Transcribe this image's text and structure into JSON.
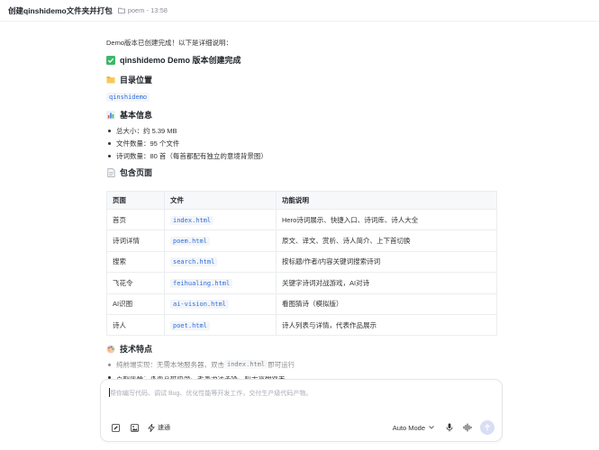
{
  "header": {
    "title": "创建qinshidemo文件夹并打包",
    "folder": "poem",
    "time": "13:58"
  },
  "message": {
    "intro": "Demo版本已创建完成！以下是详细说明：",
    "done_heading": "qinshidemo Demo 版本创建完成",
    "dir_heading": "目录位置",
    "dir_value": "qinshidemo",
    "info_heading": "基本信息",
    "info_items": [
      "总大小：约 5.39 MB",
      "文件数量：95 个文件",
      "诗词数量：80 首（每首都配有独立的意境背景图）"
    ],
    "pages_heading": "包含页面",
    "table": {
      "headers": [
        "页面",
        "文件",
        "功能说明"
      ],
      "rows": [
        [
          "首页",
          "index.html",
          "Hero诗词展示、快捷入口、诗词库、诗人大全"
        ],
        [
          "诗词详情",
          "poem.html",
          "原文、译文、赏析、诗人简介、上下首切换"
        ],
        [
          "搜索",
          "search.html",
          "按标题/作者/内容关键词搜索诗词"
        ],
        [
          "飞花令",
          "feihualing.html",
          "关键字诗词对战游戏，AI对诗"
        ],
        [
          "AI识图",
          "ai-vision.html",
          "看图猜诗（模拟版）"
        ],
        [
          "诗人",
          "poet.html",
          "诗人列表与详情，代表作品展示"
        ]
      ]
    },
    "tech_heading": "技术特点",
    "tech_items": [
      {
        "before": "纯前端实现：无需本地服务器，双击 ",
        "code": "index.html",
        "after": " 即可运行"
      },
      {
        "before": "古韵风格：水墨宣纸质感、毛笔书法字体、粒子雪梅效果",
        "code": "",
        "after": ""
      }
    ]
  },
  "composer": {
    "placeholder": "帮你编写代码、调试 Bug、优化性能等开发工作，交付生产级代码产物。",
    "speed_label": "速通",
    "mode_label": "Auto Mode"
  },
  "colors": {
    "accent": "#2f6fdb",
    "send_bg": "#d9ddf5",
    "check_green": "#3bb86a",
    "folder_yellow": "#f2b632"
  }
}
